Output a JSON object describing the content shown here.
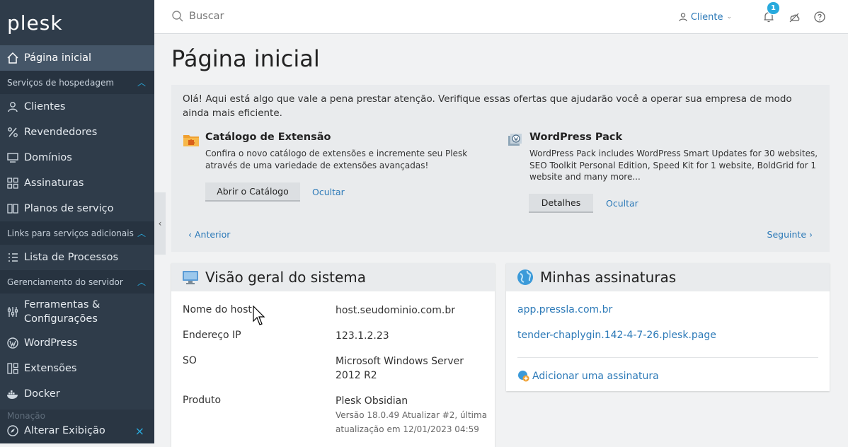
{
  "sidebar": {
    "logo": "plesk",
    "home": "Página inicial",
    "sections": [
      {
        "label": "Serviços de hospedagem",
        "items": [
          "Clientes",
          "Revendedores",
          "Domínios",
          "Assinaturas",
          "Planos de serviço"
        ]
      },
      {
        "label": "Links para serviços adicionais",
        "items": [
          "Lista de Processos"
        ]
      },
      {
        "label": "Gerenciamento do servidor",
        "items": [
          "Ferramentas &",
          "Configurações",
          "WordPress",
          "Extensões",
          "Docker"
        ]
      }
    ],
    "faded_section": "Monação",
    "change_view": "Alterar Exibição"
  },
  "topbar": {
    "search_placeholder": "Buscar",
    "client_label": "Cliente",
    "notification_count": "1"
  },
  "page_title": "Página inicial",
  "promo": {
    "intro": "Olá! Aqui está algo que vale a pena prestar atenção. Verifique essas ofertas que ajudarão você a operar sua empresa de modo ainda mais eficiente.",
    "offers": [
      {
        "title": "Catálogo de Extensão",
        "desc": "Confira o novo catálogo de extensões e incremente seu Plesk através de uma variedade de extensões avançadas!",
        "button": "Abrir o Catálogo",
        "hide": "Ocultar"
      },
      {
        "title": "WordPress Pack",
        "desc": "WordPress Pack includes WordPress Smart Updates for 30 websites, SEO Toolkit Personal Edition, Speed Kit for 1 website, BoldGrid for 1 website and many more...",
        "button": "Detalhes",
        "hide": "Ocultar"
      }
    ],
    "prev": "‹ Anterior",
    "next": "Seguinte ›"
  },
  "system_overview": {
    "title": "Visão geral do sistema",
    "rows": [
      {
        "label": "Nome do host",
        "value": "host.seudominio.com.br"
      },
      {
        "label": "Endereço IP",
        "value": "123.1.2.23"
      },
      {
        "label": "SO",
        "value": "Microsoft Windows Server 2012 R2"
      },
      {
        "label": "Produto",
        "value": "Plesk Obsidian",
        "sub": "Versão 18.0.49 Atualizar #2, última atualização em 12/01/2023 04:59"
      }
    ]
  },
  "subscriptions": {
    "title": "Minhas assinaturas",
    "items": [
      "app.pressla.com.br",
      "tender-chaplygin.142-4-7-26.plesk.page"
    ],
    "add": "Adicionar uma assinatura"
  },
  "colors": {
    "sidebar_bg": "#2f3c4a",
    "accent": "#28aadd",
    "link": "#2d7ab8"
  }
}
